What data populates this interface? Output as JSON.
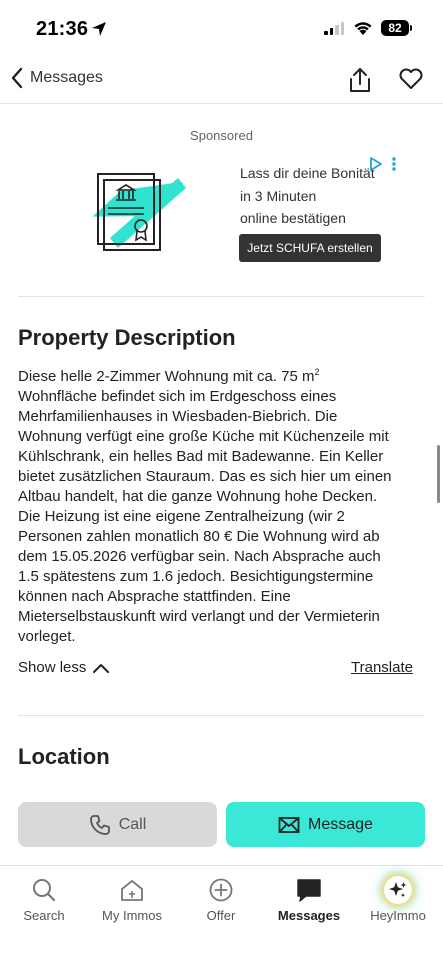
{
  "status_bar": {
    "time": "21:36",
    "battery": "82"
  },
  "header": {
    "back_label": "Messages"
  },
  "ad": {
    "sponsored_label": "Sponsored",
    "text_lines": [
      "Lass dir deine Bonität",
      "in 3 Minuten",
      "online bestätigen"
    ],
    "cta": "Jetzt SCHUFA erstellen"
  },
  "description": {
    "title": "Property Description",
    "text_before_sup": "Diese helle 2-Zimmer Wohnung mit ca. 75 m",
    "sup": "2",
    "text_after_sup": "\nWohnfläche befindet sich im Erdgeschoss eines\nMehrfamilienhauses in Wiesbaden-Biebrich. Die\nWohnung verfügt eine große Küche mit Küchenzeile mit\nKühlschrank, ein helles Bad mit Badewanne. Ein Keller\nbietet zusätzlichen Stauraum.  Das es sich hier um einen\nAltbau handelt, hat die ganze Wohnung hohe Decken.\nDie Heizung ist eine eigene Zentralheizung (wir 2\nPersonen zahlen monatlich 80 € Die Wohnung wird ab\ndem 15.05.2026 verfügbar sein. Nach Absprache auch\n1.5 spätestens zum 1.6 jedoch. Besichtigungstermine\nkönnen nach Absprache stattfinden. Eine\nMieterselbstauskunft wird verlangt und der Vermieterin\nvorleget.",
    "show_less": "Show less",
    "translate": "Translate"
  },
  "location": {
    "title": "Location"
  },
  "actions": {
    "call": "Call",
    "message": "Message"
  },
  "tabs": [
    {
      "label": "Search",
      "icon": "search-icon"
    },
    {
      "label": "My Immos",
      "icon": "home-icon"
    },
    {
      "label": "Offer",
      "icon": "plus-circle-icon"
    },
    {
      "label": "Messages",
      "icon": "chat-icon",
      "active": true
    },
    {
      "label": "HeyImmo",
      "icon": "sparkle-icon"
    }
  ],
  "colors": {
    "accent": "#3be8d8",
    "call_bg": "#d9d9d9",
    "ad_cta_bg": "#333333"
  }
}
